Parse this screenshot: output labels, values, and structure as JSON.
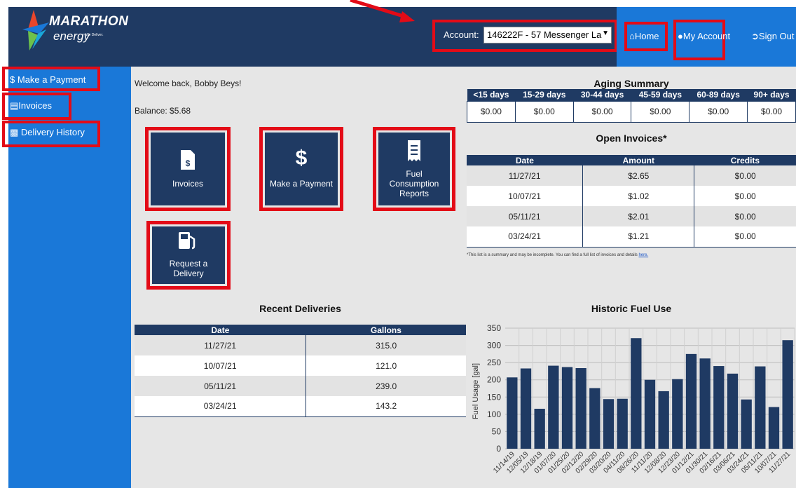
{
  "header": {
    "logo": {
      "brand": "MARATHON",
      "sub": "energy",
      "tagline": "We Deliver."
    },
    "account_label": "Account:",
    "account_value": "146222F - 57 Messenger La",
    "nav": {
      "home": "Home",
      "my_account": "My Account",
      "sign_out": "Sign Out"
    }
  },
  "sidebar": {
    "items": [
      {
        "label": "Make a Payment",
        "icon": "dollar-icon"
      },
      {
        "label": "Invoices",
        "icon": "invoice-icon"
      },
      {
        "label": "Delivery History",
        "icon": "truck-icon"
      }
    ]
  },
  "main": {
    "welcome": "Welcome back, Bobby Beys!",
    "balance": "Balance: $5.68",
    "tiles": [
      {
        "label": "Invoices",
        "icon": "invoice-dollar-icon"
      },
      {
        "label": "Make a Payment",
        "icon": "dollar-icon"
      },
      {
        "label_line1": "Fuel",
        "label_line2": "Consumption",
        "label_line3": "Reports",
        "icon": "receipt-icon"
      },
      {
        "label_line1": "Request a",
        "label_line2": "Delivery",
        "icon": "gas-pump-icon"
      }
    ]
  },
  "aging": {
    "title": "Aging Summary",
    "headers": [
      "<15 days",
      "15-29 days",
      "30-44 days",
      "45-59 days",
      "60-89 days",
      "90+ days"
    ],
    "values": [
      "$0.00",
      "$0.00",
      "$0.00",
      "$0.00",
      "$0.00",
      "$0.00"
    ]
  },
  "open_invoices": {
    "title": "Open Invoices*",
    "headers": [
      "Date",
      "Amount",
      "Credits"
    ],
    "rows": [
      [
        "11/27/21",
        "$2.65",
        "$0.00"
      ],
      [
        "10/07/21",
        "$1.02",
        "$0.00"
      ],
      [
        "05/11/21",
        "$2.01",
        "$0.00"
      ],
      [
        "03/24/21",
        "$1.21",
        "$0.00"
      ]
    ],
    "footnote": "*This list is a summary and may be incomplete. You can find a full list of invoices and details",
    "footnote_link": "here."
  },
  "deliveries": {
    "title": "Recent Deliveries",
    "headers": [
      "Date",
      "Gallons"
    ],
    "rows": [
      [
        "11/27/21",
        "315.0"
      ],
      [
        "10/07/21",
        "121.0"
      ],
      [
        "05/11/21",
        "239.0"
      ],
      [
        "03/24/21",
        "143.2"
      ]
    ]
  },
  "chart_data": {
    "type": "bar",
    "title": "Historic Fuel Use",
    "ylabel": "Fuel Usage [gal]",
    "xlabel": "",
    "ylim": [
      0,
      350
    ],
    "yticks": [
      0,
      50,
      100,
      150,
      200,
      250,
      300,
      350
    ],
    "categories": [
      "11/14/19",
      "12/05/19",
      "12/18/19",
      "01/07/20",
      "01/25/20",
      "02/12/20",
      "02/29/20",
      "03/20/20",
      "04/11/20",
      "08/26/20",
      "11/11/20",
      "12/08/20",
      "12/23/20",
      "01/12/21",
      "01/30/21",
      "02/16/21",
      "03/06/21",
      "03/24/21",
      "05/11/21",
      "10/07/21",
      "11/27/21"
    ],
    "values": [
      207,
      233,
      116,
      241,
      237,
      234,
      176,
      144,
      145,
      321,
      200,
      167,
      202,
      275,
      262,
      240,
      218,
      143,
      239,
      121,
      315
    ],
    "bar_color": "#1f3a63",
    "grid": true
  },
  "colors": {
    "header": "#1f3a63",
    "accent_blue": "#1a78d8",
    "highlight": "#e30b17",
    "panel_bg": "#e6e6e6"
  }
}
